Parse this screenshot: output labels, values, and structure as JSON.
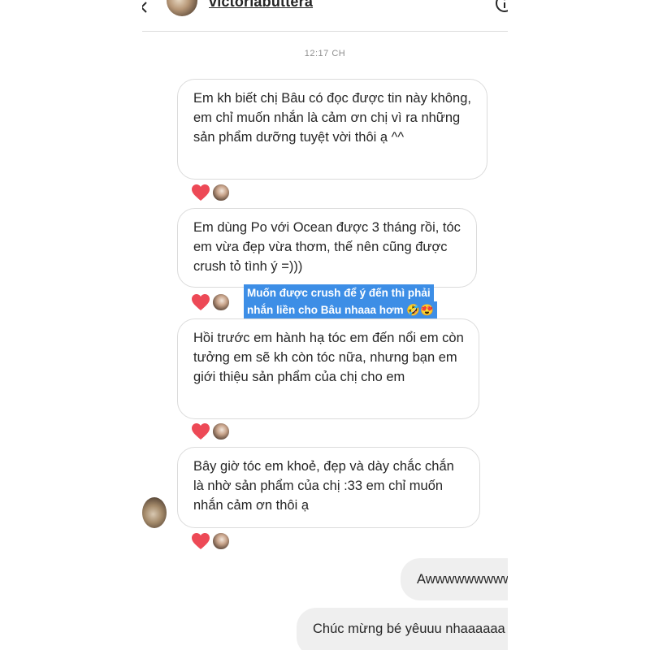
{
  "header": {
    "username": "victoriabuttera",
    "back_icon": "chevron-left-icon",
    "info_icon": "info-icon"
  },
  "timestamp": "12:17 CH",
  "messages": [
    {
      "text": "Em kh biết chị Bâu có đọc được tin này không, em chỉ muốn nhắn là cảm ơn chị vì ra những sản phẩm dưỡng tuyệt vời thôi ạ ^^",
      "reaction": "heart-icon"
    },
    {
      "text": "Em dùng Po với Ocean được 3 tháng rồi, tóc em vừa đẹp vừa thơm, thế nên cũng được crush tỏ tình ý =)))",
      "reaction": "heart-icon"
    },
    {
      "text": "Hồi trước em hành hạ tóc em đến nổi em còn tưởng em sẽ kh còn tóc nữa, nhưng bạn em giới thiệu sản phẩm của chị cho em",
      "reaction": "heart-icon"
    },
    {
      "text": "Bây giờ tóc em khoẻ, đẹp và dày chắc chắn là nhờ sản phẩm của chị :33 em chỉ muốn nhắn cảm ơn thôi ạ",
      "reaction": "heart-icon"
    }
  ],
  "caption": {
    "line1": "Muốn được crush để ý đến thì phải",
    "line2": "nhắn liền cho Bâu nhaaa hơm 🤣😍"
  },
  "replies": [
    {
      "text": "Awwwwwwwwww"
    },
    {
      "text": "Chúc mừng bé yêuuu nhaaaaaa"
    }
  ],
  "colors": {
    "heart": "#ed4956",
    "caption_bg": "#3d8ee6",
    "outgoing_bg": "#efefef",
    "border": "#dbdbdb"
  }
}
